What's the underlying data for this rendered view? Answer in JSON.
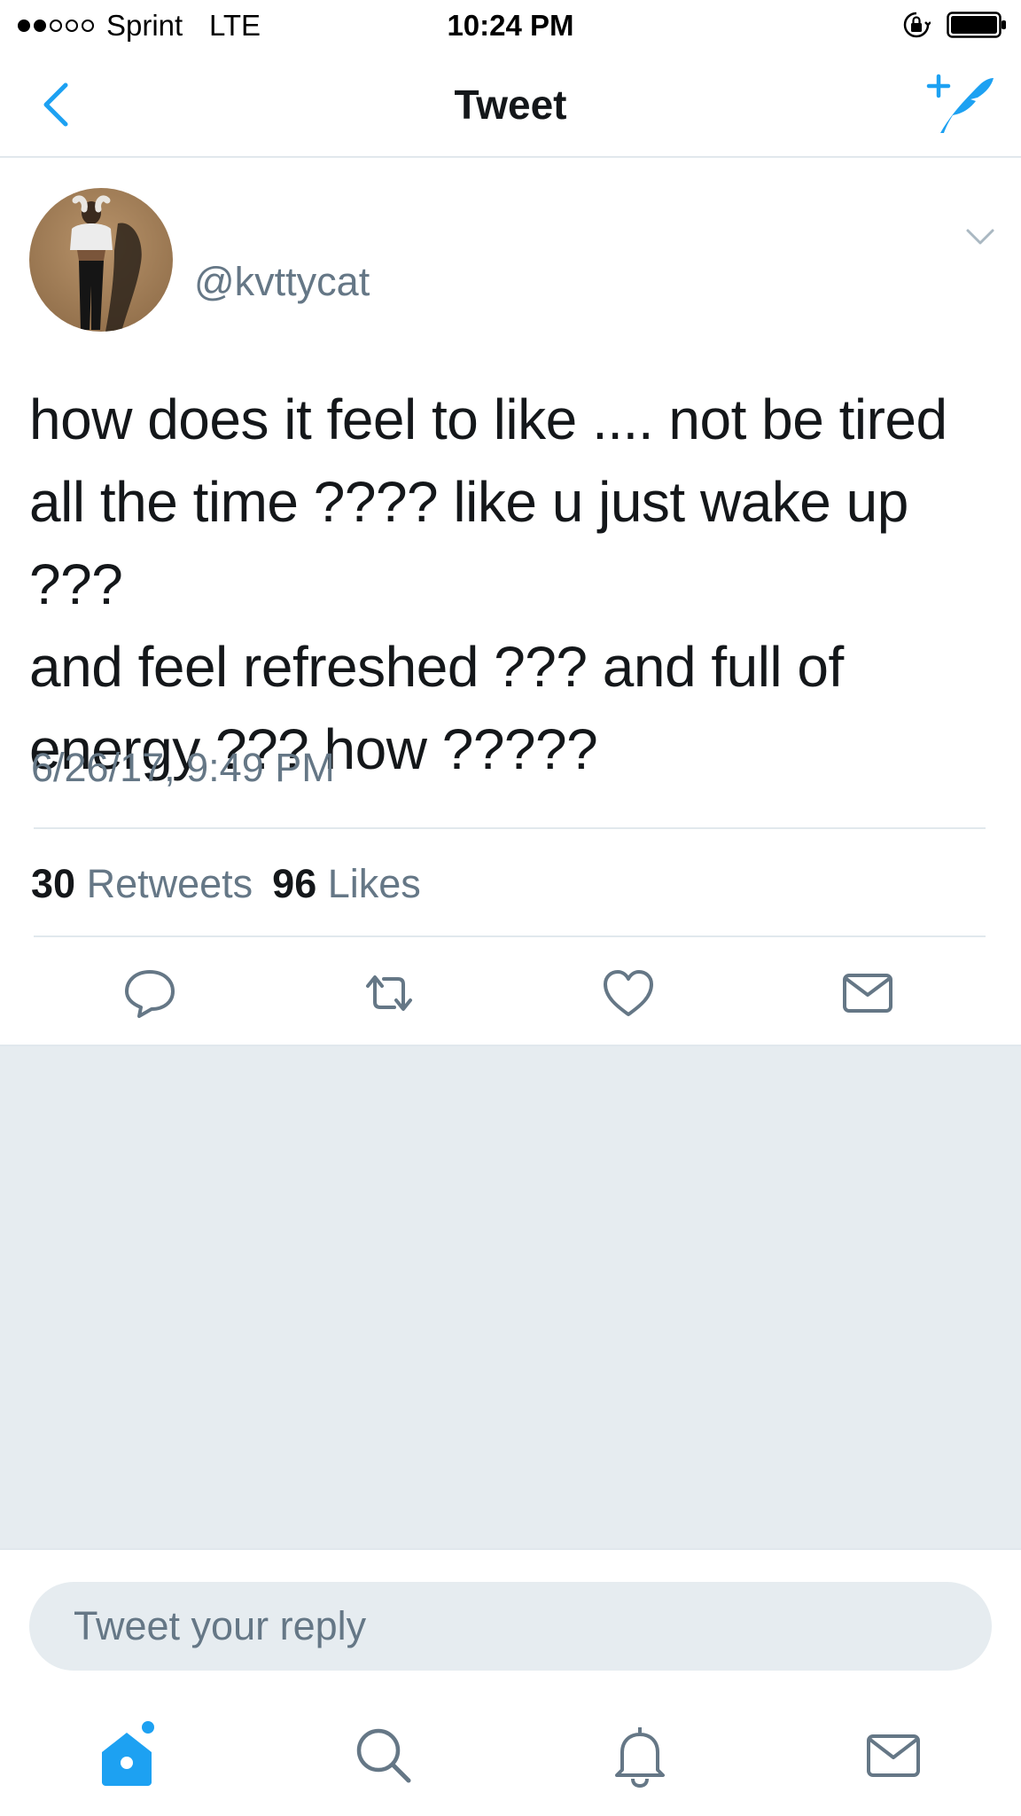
{
  "status_bar": {
    "carrier": "Sprint",
    "network": "LTE",
    "time": "10:24 PM"
  },
  "nav": {
    "title": "Tweet"
  },
  "tweet": {
    "handle": "@kvttycat",
    "text": "how does it feel to like .... not be tired\nall the time ???? like u just wake up ???\nand feel refreshed ??? and full of\nenergy ??? how ?????",
    "timestamp": "6/26/17, 9:49 PM",
    "retweets_count": "30",
    "retweets_label": "Retweets",
    "likes_count": "96",
    "likes_label": "Likes"
  },
  "reply": {
    "placeholder": "Tweet your reply"
  },
  "colors": {
    "accent": "#1da1f2",
    "muted": "#657786",
    "background_gray": "#e6ecf0"
  },
  "icons": {
    "back": "chevron-left-icon",
    "compose": "compose-tweet-icon",
    "reply": "reply-bubble-icon",
    "retweet": "retweet-icon",
    "like": "heart-icon",
    "dm": "envelope-icon",
    "home": "home-icon",
    "search": "search-icon",
    "notifications": "bell-icon",
    "messages": "envelope-icon"
  }
}
